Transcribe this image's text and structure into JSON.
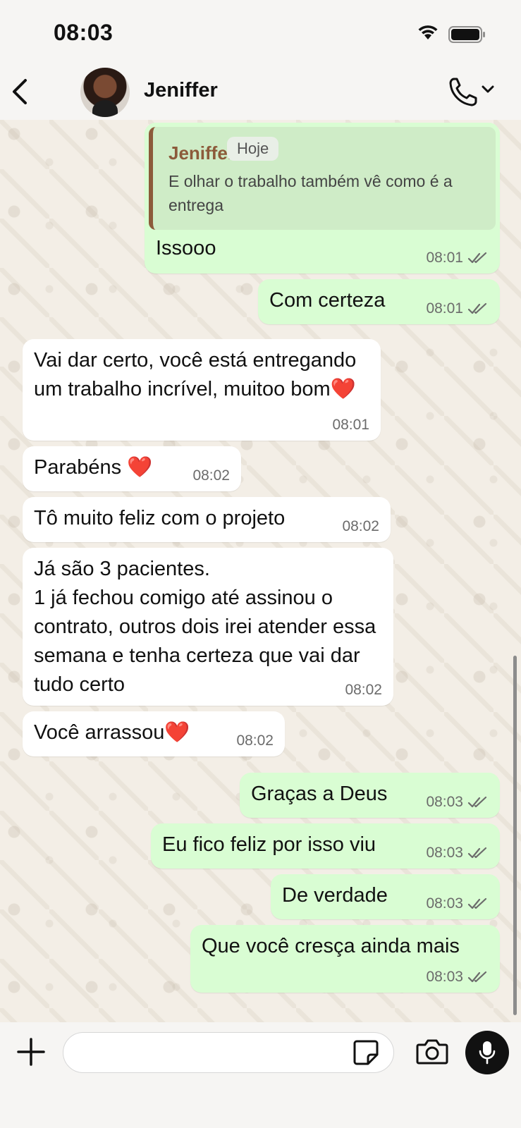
{
  "status_bar": {
    "time": "08:03"
  },
  "header": {
    "contact_name": "Jeniffer"
  },
  "date_chip": "Hoje",
  "messages": [
    {
      "direction": "out",
      "reply_to": {
        "name": "Jeniffer",
        "text": "E olhar o trabalho também vê como é a entrega"
      },
      "text": "Issooo",
      "time": "08:01",
      "read": true
    },
    {
      "direction": "out",
      "text": "Com certeza",
      "time": "08:01",
      "read": true
    },
    {
      "direction": "in",
      "text": "Vai dar certo, você está entregando um trabalho incrível, muitoo bom❤️",
      "time": "08:01"
    },
    {
      "direction": "in",
      "text": "Parabéns ❤️",
      "time": "08:02"
    },
    {
      "direction": "in",
      "text": "Tô muito feliz com o projeto",
      "time": "08:02"
    },
    {
      "direction": "in",
      "text": "Já são 3 pacientes.\n1 já fechou comigo até assinou o contrato, outros dois irei atender essa semana e tenha certeza que vai dar tudo certo",
      "time": "08:02"
    },
    {
      "direction": "in",
      "text": "Você arrassou❤️",
      "time": "08:02"
    },
    {
      "direction": "out",
      "text": "Graças a Deus",
      "time": "08:03",
      "read": true
    },
    {
      "direction": "out",
      "text": "Eu fico feliz por isso viu",
      "time": "08:03",
      "read": true
    },
    {
      "direction": "out",
      "text": "De verdade",
      "time": "08:03",
      "read": true
    },
    {
      "direction": "out",
      "text": "Que você cresça ainda mais",
      "time": "08:03",
      "read": true
    }
  ],
  "composer": {
    "input_value": "",
    "input_placeholder": ""
  },
  "icons": {
    "back": "chevron-left-icon",
    "call": "phone-icon",
    "plus": "plus-icon",
    "sticker": "sticker-icon",
    "camera": "camera-icon",
    "mic": "microphone-icon",
    "read_receipt": "double-check-icon"
  },
  "colors": {
    "outgoing_bubble": "#d9fdd3",
    "incoming_bubble": "#ffffff",
    "quote_accent": "#8c5a3a"
  }
}
